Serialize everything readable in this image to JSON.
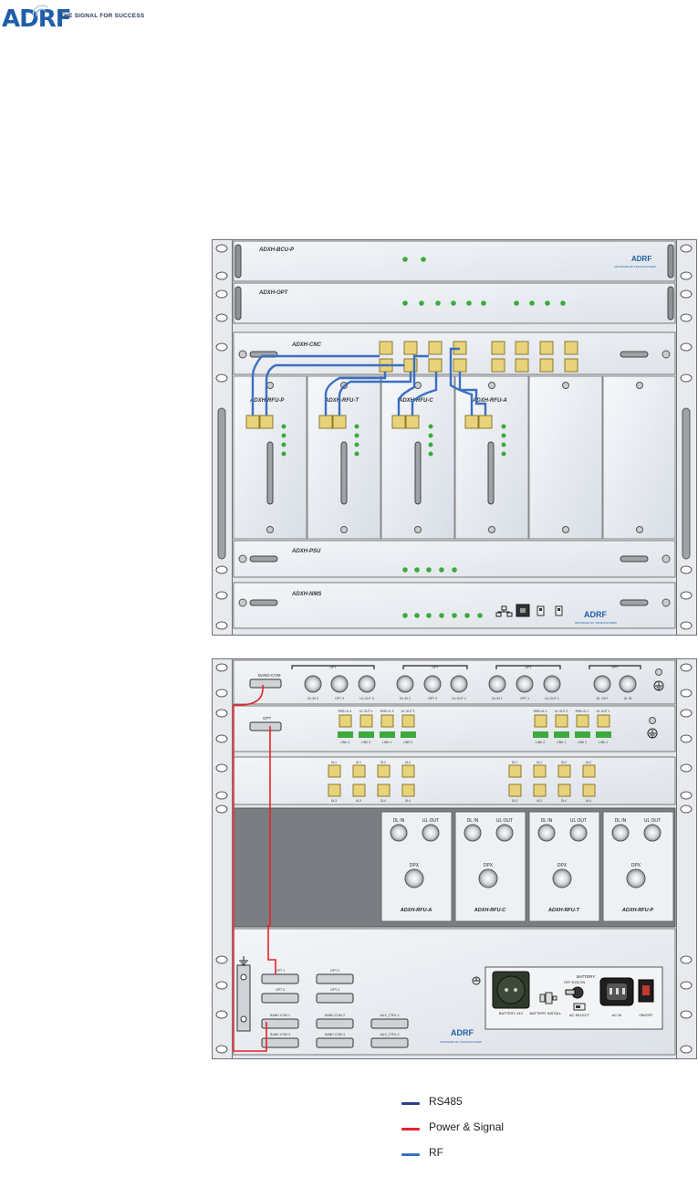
{
  "header": {
    "logo_text": "ADRF",
    "tagline": "THE SIGNAL FOR SUCCESS"
  },
  "front_panel": {
    "modules": {
      "bcu": "ADXH-BCU-P",
      "opt": "ADXH-OPT",
      "cnc": "ADXH-CNC",
      "rfu_p": "ADXH-RFU-P",
      "rfu_t": "ADXH-RFU-T",
      "rfu_c": "ADXH-RFU-C",
      "rfu_a": "ADXH-RFU-A",
      "psu": "ADXH-PSU",
      "nms": "ADXH-NMS"
    },
    "brand": "ADRF",
    "brand_sub": "ADVANCED RF TECHNOLOGIES"
  },
  "rear_panel": {
    "bcu_port": "BAND-COM",
    "opt_port": "OPT",
    "bcu_rf_groups": [
      "OPT",
      "OPT",
      "OPT",
      "OPT"
    ],
    "bcu_rf_labels": [
      "DL IN 3",
      "OPT 3",
      "UL OUT 3",
      "DL IN 2",
      "OPT 2",
      "UL OUT 2",
      "DL IN 1",
      "OPT 1",
      "UL OUT 1",
      "DL OUT",
      "UL IN"
    ],
    "opt_labels_left": [
      "RHB UL 4",
      "UL OUT 4",
      "RHB UL 3",
      "UL OUT 3"
    ],
    "opt_labels_right": [
      "RHB UL 2",
      "UL OUT 2",
      "RHB UL 1",
      "UL OUT 1"
    ],
    "opt_led_left": [
      "LINK 4",
      "LINK 3",
      "LINK 4",
      "LINK 3"
    ],
    "opt_led_right": [
      "LINK 2",
      "LINK 1",
      "LINK 2",
      "LINK 1"
    ],
    "cnc_top": [
      "DL1",
      "UL1",
      "DL2",
      "UL2"
    ],
    "cnc_bottom": [
      "DL3",
      "UL3",
      "DL4",
      "UL4"
    ],
    "rfu_cards": [
      {
        "dl": "DL IN",
        "ul": "UL OUT",
        "dpx": "DPX",
        "name": "ADXH-RFU-A"
      },
      {
        "dl": "DL IN",
        "ul": "UL OUT",
        "dpx": "DPX",
        "name": "ADXH-RFU-C"
      },
      {
        "dl": "DL IN",
        "ul": "UL OUT",
        "dpx": "DPX",
        "name": "ADXH-RFU-T"
      },
      {
        "dl": "DL IN",
        "ul": "UL OUT",
        "dpx": "DPX",
        "name": "ADXH-RFU-P"
      }
    ],
    "db_ports": [
      "OPT 1",
      "OPT 2",
      "OPT 3",
      "OPT 4",
      "BAND COM 1",
      "BAND COM 2",
      "BAND COM 3",
      "BAND COM 4",
      "AUX_CTRL 1",
      "AUX_CTRL 2"
    ],
    "battery_label": "BATTERY",
    "battery_states": "OFF  EXN  ON",
    "battery_conn": "BATTERY\n24V",
    "battery_install": "BATTERY\nINSTALL",
    "ac_select": "AC SELECT",
    "ac_in": "AC IN",
    "power_switch": "ON/OFF",
    "plus_minus": "+\n-"
  },
  "legend": [
    {
      "label": "RS485",
      "color": "#2e3f8f"
    },
    {
      "label": "Power & Signal",
      "color": "#e8232a"
    },
    {
      "label": "RF",
      "color": "#3b6fc1"
    }
  ],
  "colors": {
    "rs485": "#2e3f8f",
    "power": "#e8232a",
    "rf": "#3b6fc1",
    "led": "#3caa3c",
    "connector": "#e8d37a",
    "panel": "#e9edf2",
    "frame": "#dadde2"
  }
}
